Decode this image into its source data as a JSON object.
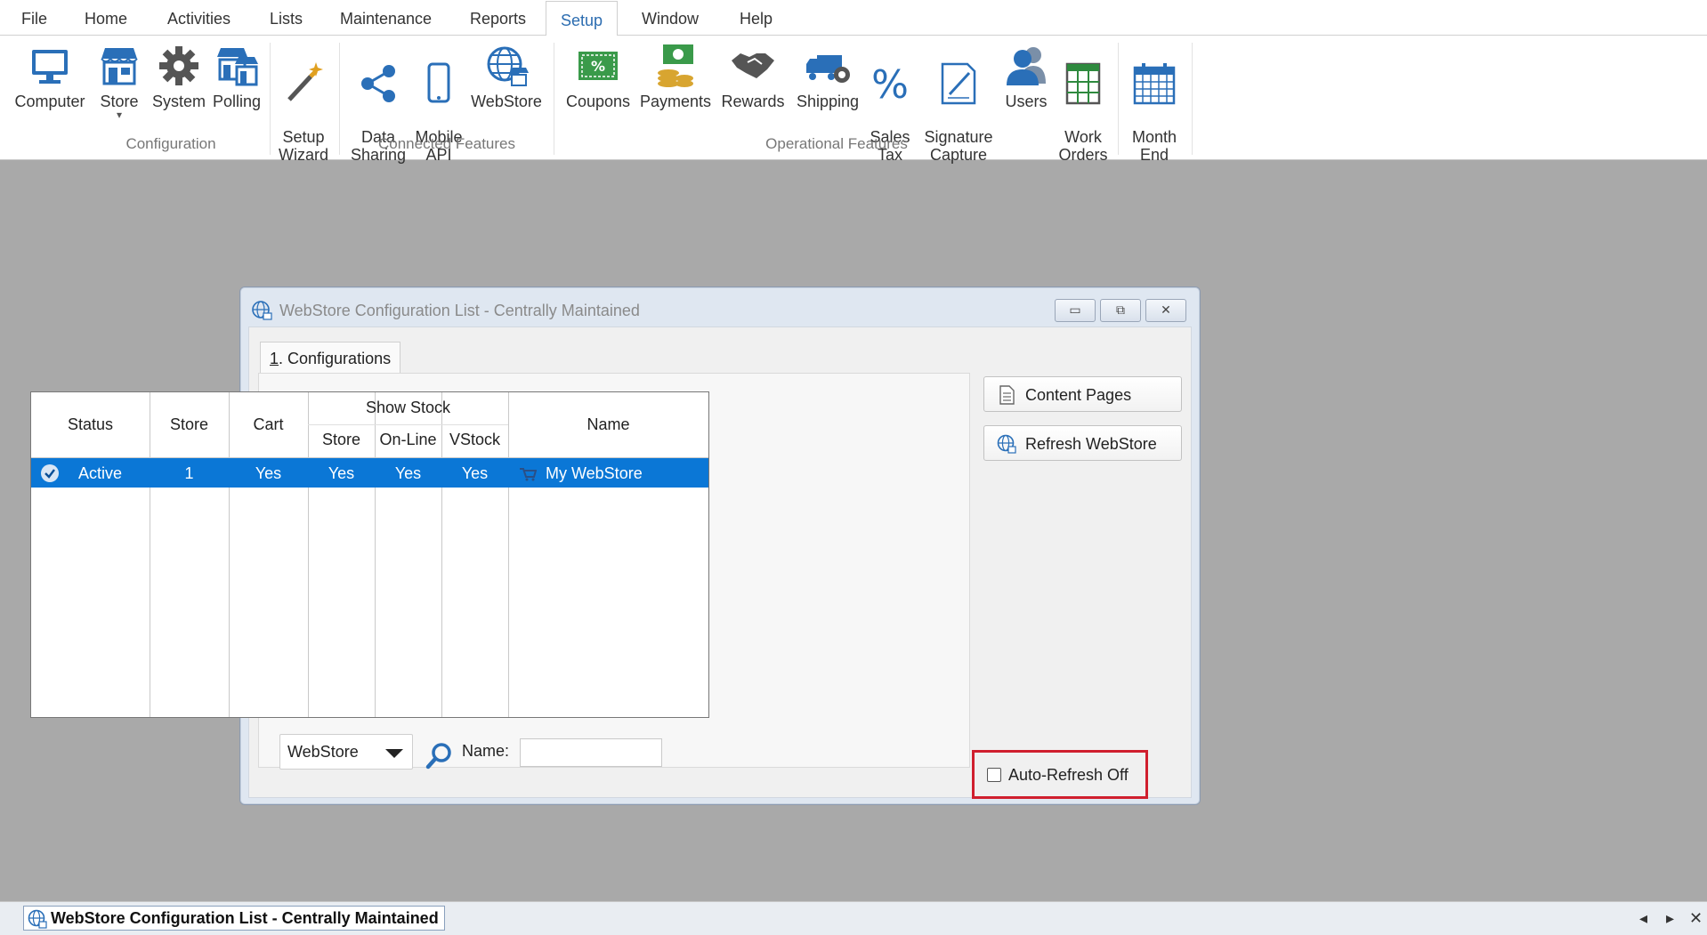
{
  "menu": {
    "items": [
      "File",
      "Home",
      "Activities",
      "Lists",
      "Maintenance",
      "Reports",
      "Setup",
      "Window",
      "Help"
    ],
    "active": "Setup"
  },
  "ribbon": {
    "buttons": [
      {
        "label": "Computer",
        "icon": "computer-icon"
      },
      {
        "label": "Store",
        "icon": "store-icon",
        "dropdown": "▾"
      },
      {
        "label": "System",
        "icon": "gear-icon"
      },
      {
        "label": "Polling",
        "icon": "polling-store-icon"
      },
      {
        "label": "Setup\nWizard",
        "icon": "magic-wand-icon"
      },
      {
        "label": "Data\nSharing",
        "icon": "share-icon"
      },
      {
        "label": "Mobile\nAPI",
        "icon": "mobile-phone-icon"
      },
      {
        "label": "WebStore",
        "icon": "globe-store-icon"
      },
      {
        "label": "Coupons",
        "icon": "coupon-icon"
      },
      {
        "label": "Payments",
        "icon": "money-icon"
      },
      {
        "label": "Rewards",
        "icon": "handshake-icon"
      },
      {
        "label": "Shipping",
        "icon": "truck-icon"
      },
      {
        "label": "Sales\nTax",
        "icon": "percent-icon"
      },
      {
        "label": "Signature\nCapture",
        "icon": "signature-icon"
      },
      {
        "label": "Users",
        "icon": "users-icon"
      },
      {
        "label": "Work\nOrders",
        "icon": "work-orders-icon"
      },
      {
        "label": "Month\nEnd",
        "icon": "calendar-icon"
      }
    ],
    "groups": [
      "Configuration",
      "Connected Features",
      "Operational Features"
    ]
  },
  "window": {
    "title": "WebStore Configuration List - Centrally Maintained",
    "controls": {
      "minimize": "▭",
      "restore": "⧉",
      "close": "✕"
    },
    "tab": {
      "mnemonic": "1",
      "label": ". Configurations"
    },
    "grid": {
      "headers": {
        "status": "Status",
        "store": "Store",
        "cart": "Cart",
        "show_stock": "Show Stock",
        "ss_store": "Store",
        "ss_online": "On-Line",
        "ss_vstock": "VStock",
        "name": "Name"
      },
      "rows": [
        {
          "status": "Active",
          "store": "1",
          "cart": "Yes",
          "ss_store": "Yes",
          "ss_online": "Yes",
          "ss_vstock": "Yes",
          "name": "My WebStore"
        }
      ]
    },
    "filter": {
      "dropdown_value": "WebStore",
      "name_label": "Name:",
      "name_value": ""
    },
    "side_buttons": {
      "content_pages": "Content Pages",
      "refresh_webstore": "Refresh WebStore"
    },
    "auto_refresh": {
      "label": "Auto-Refresh Off",
      "checked": false
    }
  },
  "taskbar": {
    "item": "WebStore Configuration List - Centrally Maintained",
    "controls": {
      "prev": "◂",
      "next": "▸",
      "close": "✕"
    }
  },
  "colors": {
    "selection": "#0b77d6",
    "accent": "#2b6cb0",
    "highlight_border": "#d01f2e",
    "icon_blue": "#2a6fb8"
  }
}
